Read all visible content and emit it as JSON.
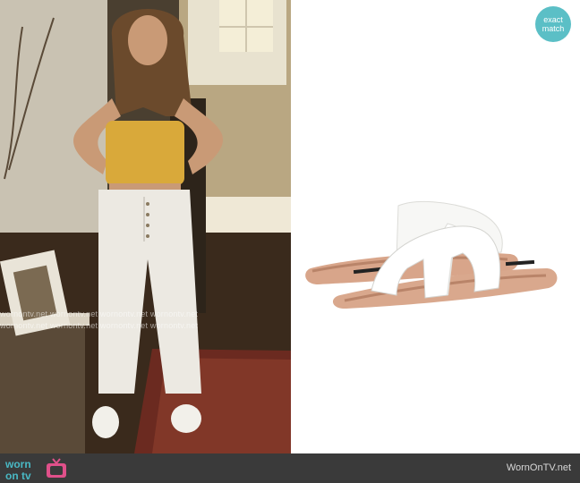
{
  "badge": {
    "line1": "exact",
    "line2": "match"
  },
  "watermarks": [
    "wornontv.net wornontv.net wornontv.net wornontv.net",
    "wornontv.net wornontv.net wornontv.net wornontv.net"
  ],
  "footer": {
    "logo_line1": "worn",
    "logo_line2": "on tv",
    "site_name": "WornOnTV.net"
  },
  "colors": {
    "badge": "#5bbfc6",
    "footer_bg": "#3a3a3a",
    "logo": "#49b8c4"
  },
  "icons": [
    "tv-icon"
  ]
}
